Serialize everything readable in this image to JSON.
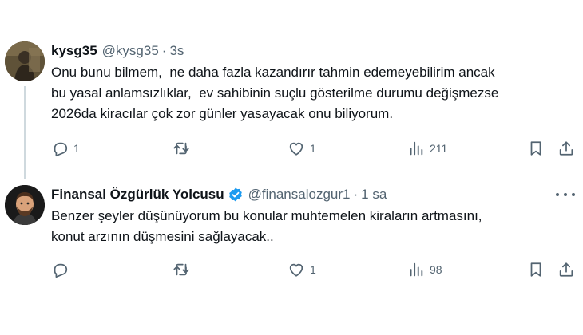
{
  "tweets": [
    {
      "display_name": "kysg35",
      "handle": "@kysg35",
      "separator": "·",
      "time": "3s",
      "verified": false,
      "text_lines": [
        "Onu bunu bilmem,  ne daha fazla kazandırır tahmin edemeyebilirim ancak",
        "bu yasal anlamsızlıklar,  ev sahibinin suçlu gösterilme durumu değişmezse",
        "2026da kiracılar çok zor günler yasayacak onu biliyorum."
      ],
      "replies": "1",
      "reposts": "",
      "likes": "1",
      "views": "211"
    },
    {
      "display_name": "Finansal Özgürlük Yolcusu",
      "handle": "@finansalozgur1",
      "separator": "·",
      "time": "1 sa",
      "verified": true,
      "text_lines": [
        "Benzer şeyler düşünüyorum bu konular muhtemelen kiraların artmasını,",
        "konut arzının düşmesini sağlayacak.."
      ],
      "replies": "",
      "reposts": "",
      "likes": "1",
      "views": "98"
    }
  ],
  "icons": {
    "reply": "reply-icon",
    "repost": "repost-icon",
    "like": "heart-icon",
    "views": "views-chart-icon",
    "bookmark": "bookmark-icon",
    "share": "share-icon",
    "more": "more-dots-icon",
    "verified": "verified-badge-icon"
  },
  "colors": {
    "text": "#0f1419",
    "secondary": "#536471",
    "verified": "#1d9bf0",
    "thread_line": "#cfd9de"
  }
}
